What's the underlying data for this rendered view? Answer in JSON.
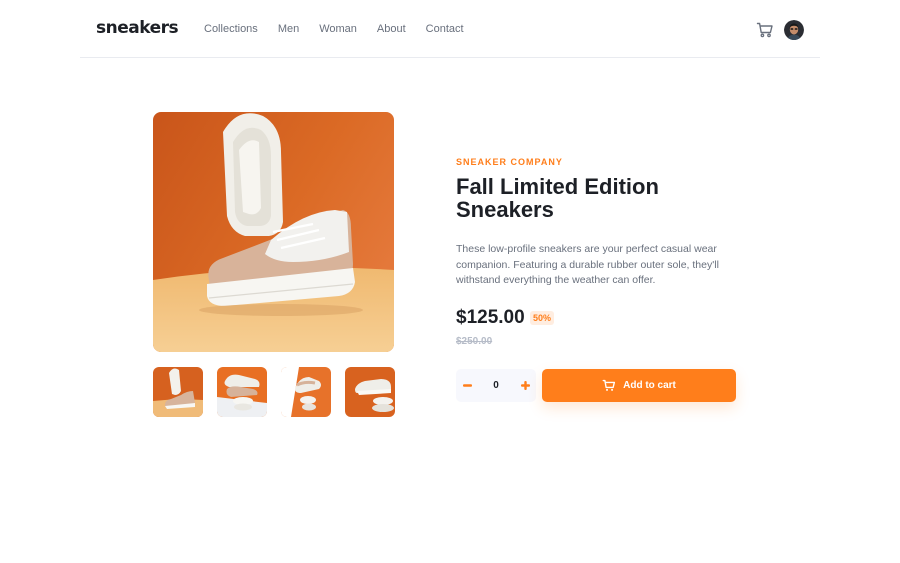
{
  "brand": {
    "logo": "sneakers"
  },
  "nav": {
    "items": [
      {
        "label": "Collections"
      },
      {
        "label": "Men"
      },
      {
        "label": "Woman"
      },
      {
        "label": "About"
      },
      {
        "label": "Contact"
      }
    ]
  },
  "header": {
    "cart_icon": "cart-icon",
    "avatar": "user-avatar"
  },
  "gallery": {
    "main_image": "sneaker-hero-photo",
    "thumbnails": [
      "thumbnail-1",
      "thumbnail-2",
      "thumbnail-3",
      "thumbnail-4"
    ]
  },
  "product": {
    "company": "SNEAKER COMPANY",
    "title": "Fall Limited Edition Sneakers",
    "description": "These low-profile sneakers are your perfect casual wear companion. Featuring a durable rubber outer sole, they'll withstand everything the weather can offer.",
    "price": "$125.00",
    "discount": "50%",
    "original_price": "$250.00"
  },
  "cart_controls": {
    "quantity": "0",
    "minus_icon": "minus-icon",
    "plus_icon": "plus-icon",
    "add_label": "Add to cart"
  },
  "colors": {
    "accent": "#ff7e1b",
    "accent_pale": "#ffede0",
    "dark": "#1d2026",
    "gray": "#69707d",
    "light_gray": "#b6bcc8",
    "qty_bg": "#f7f8fd"
  }
}
